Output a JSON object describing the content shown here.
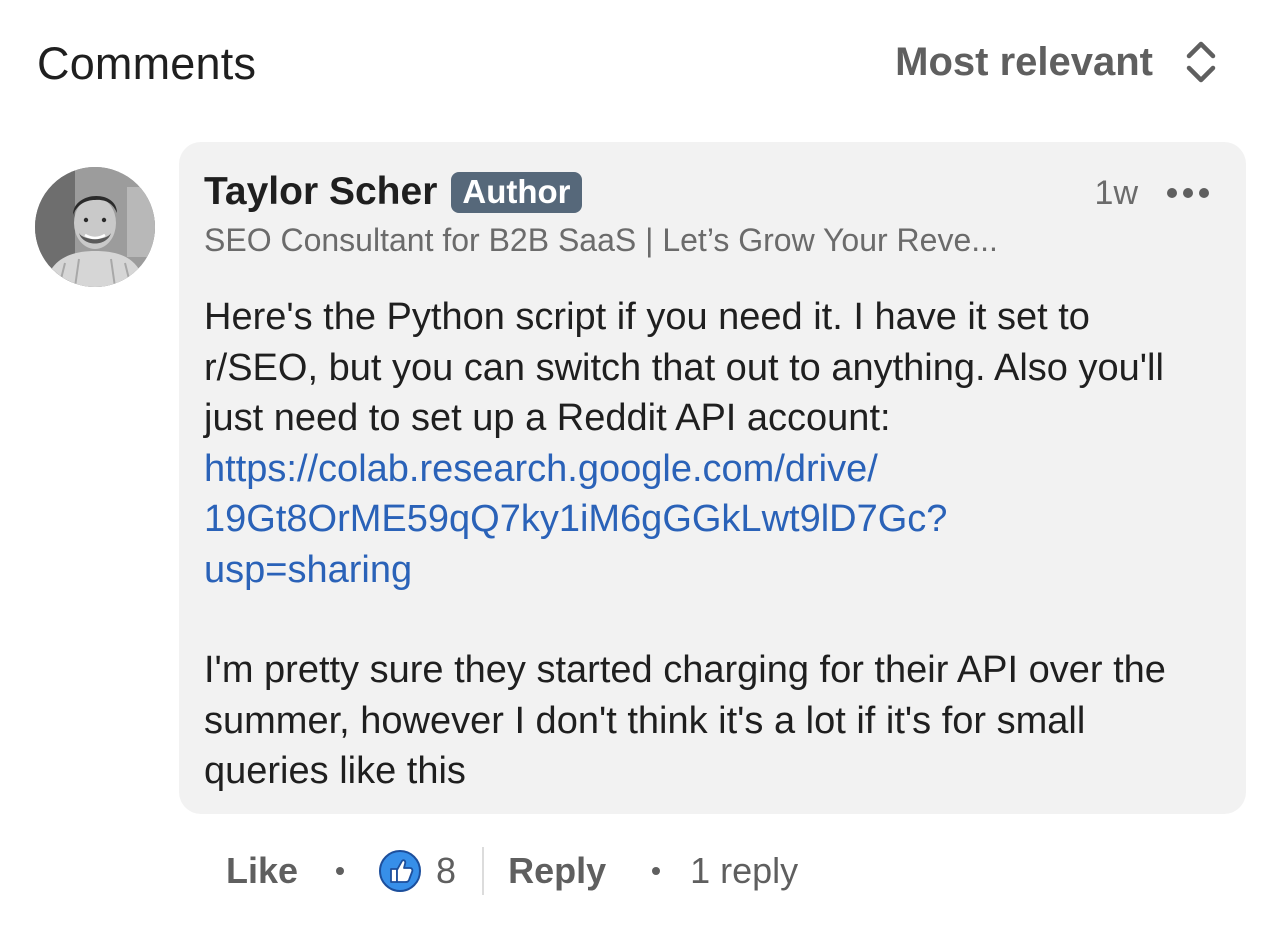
{
  "header": {
    "title": "Comments",
    "sort_label": "Most relevant",
    "sort_icon": "chevron-up-down-icon"
  },
  "comment": {
    "avatar_icon": "avatar-photo",
    "author_name": "Taylor Scher",
    "badge": "Author",
    "time": "1w",
    "more_icon": "more-options-icon",
    "headline": "SEO Consultant for B2B SaaS | Let’s Grow Your Reve...",
    "body": {
      "paragraph1": "Here's the Python script if you need it. I have it set to r/SEO, but you can switch that out to anything. Also you'll just need to set up a Reddit API account:",
      "link_line1": "https://colab.research.google.com/drive/",
      "link_line2": "19Gt8OrME59qQ7ky1iM6gGGkLwt9lD7Gc?",
      "link_line3": "usp=sharing",
      "paragraph2": "I'm pretty sure they started charging for their API over the summer, however I don't think it's a lot if it's for small queries like this"
    }
  },
  "actions": {
    "like_label": "Like",
    "reaction_icon": "thumbs-up-icon",
    "reaction_count": "8",
    "reply_label": "Reply",
    "replies_label": "1 reply"
  },
  "colors": {
    "link": "#2a62b8",
    "badge_bg": "#56687a",
    "bubble_bg": "#f2f2f2",
    "like_icon_bg": "#378fe9"
  }
}
